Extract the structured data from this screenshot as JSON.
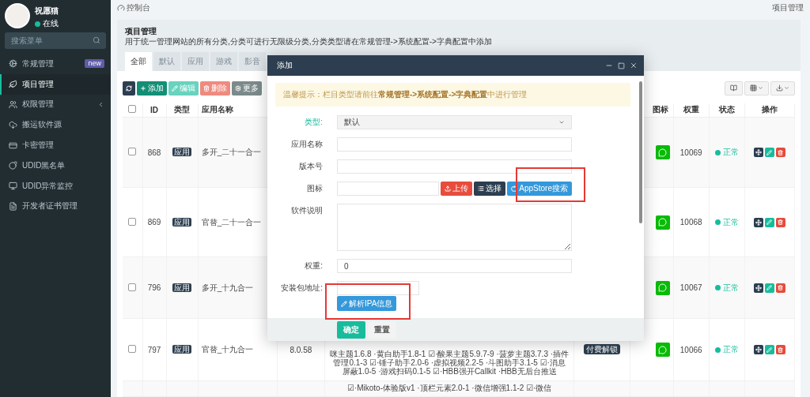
{
  "sidebar": {
    "user": {
      "name": "祝愿猫",
      "status": "在线"
    },
    "search": {
      "placeholder": "搜索菜单"
    },
    "items": [
      {
        "label": "常规管理",
        "badge": "new",
        "selected": false,
        "expandable": false
      },
      {
        "label": "项目管理",
        "selected": true,
        "expandable": false
      },
      {
        "label": "权限管理",
        "selected": false,
        "expandable": true
      },
      {
        "label": "搬运软件源",
        "selected": false,
        "expandable": false
      },
      {
        "label": "卡密管理",
        "selected": false,
        "expandable": false
      },
      {
        "label": "UDID黑名单",
        "selected": false,
        "expandable": false
      },
      {
        "label": "UDID异常监控",
        "selected": false,
        "expandable": false
      },
      {
        "label": "开发者证书管理",
        "selected": false,
        "expandable": false
      }
    ]
  },
  "breadcrumb": {
    "left": "控制台",
    "right": "项目管理"
  },
  "panel": {
    "title": "项目管理",
    "description": "用于统一管理网站的所有分类,分类可进行无限级分类,分类类型请在常规管理->系统配置->字典配置中添加",
    "tabs": [
      {
        "label": "全部",
        "selected": true
      },
      {
        "label": "默认",
        "selected": false
      },
      {
        "label": "应用",
        "selected": false
      },
      {
        "label": "游戏",
        "selected": false
      },
      {
        "label": "影音",
        "selected": false
      }
    ]
  },
  "toolbar": {
    "buttons": [
      {
        "kind": "refresh",
        "disabled": false
      },
      {
        "kind": "add",
        "label": "添加",
        "disabled": false
      },
      {
        "kind": "edit",
        "label": "编辑",
        "disabled": true
      },
      {
        "kind": "delete",
        "label": "删除",
        "disabled": true
      },
      {
        "kind": "more",
        "label": "更多",
        "disabled": false
      }
    ]
  },
  "table": {
    "header_checked": false,
    "columns": [
      "ID",
      "类型",
      "应用名称",
      "图标",
      "权重",
      "状态",
      "操作"
    ],
    "rows": [
      {
        "checked": false,
        "id": "868",
        "type": "应用",
        "name": "多开_二十一合一",
        "weight": "10069",
        "status": "正常"
      },
      {
        "checked": false,
        "id": "869",
        "type": "应用",
        "name": "官替_二十一合一",
        "weight": "10068",
        "status": "正常"
      },
      {
        "checked": false,
        "id": "796",
        "type": "应用",
        "name": "多开_十九合一",
        "weight": "10067",
        "status": "正常"
      },
      {
        "checked": false,
        "id": "797",
        "type": "应用",
        "name": "官替_十九合一",
        "version": "8.0.58",
        "description": "咪主题1.6.8 ·黄白助手1.8-1 ☑·酸果主题5.9.7-9 ·菠萝主题3.7.3 ·插件管理0.1-3 ☑·锤子助手2.0-6 ·虚拟视频2.2-5 ·斗图助手3.1-5 ☑·消息屏蔽1.0-5 ·游戏扫码0.1-5 ☑·HBB强开Callkit ·HBB无后台推送",
        "tag": "付费解锁",
        "weight": "10066",
        "status": "正常"
      },
      {
        "description": "☑·Mikoto-体验版v1 ·顶栏元素2.0-1 ·微信增强1.1-2 ☑·微信"
      }
    ]
  },
  "dialog": {
    "title": "添加",
    "notice": "温馨提示：栏目类型请前往**常规管理->系统配置->字典配置**中进行管理",
    "fields": [
      {
        "kind": "select",
        "label": "类型:",
        "value": "默认",
        "valid": true
      },
      {
        "kind": "text",
        "label": "应用名称",
        "valid": false
      },
      {
        "kind": "text",
        "label": "版本号",
        "valid": false
      },
      {
        "kind": "image",
        "label": "图标",
        "buttons": [
          "上传",
          "选择",
          "AppStore搜索"
        ],
        "valid": false
      },
      {
        "kind": "textarea",
        "label": "软件说明",
        "valid": false
      },
      {
        "kind": "text",
        "label": "权重:",
        "value": "0",
        "valid": false
      },
      {
        "kind": "package",
        "label": "安装包地址:",
        "button": "解析IPA信息",
        "valid": false
      }
    ],
    "buttons": [
      {
        "kind": "primary",
        "label": "确定"
      },
      {
        "kind": "default",
        "label": "重置"
      }
    ]
  }
}
